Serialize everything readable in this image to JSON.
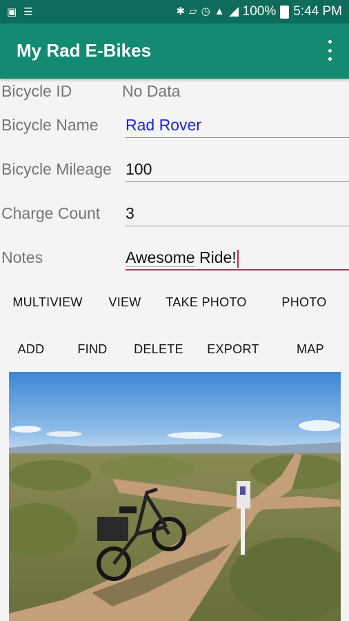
{
  "status_bar": {
    "battery": "100%",
    "time": "5:44 PM"
  },
  "app_bar": {
    "title": "My Rad E-Bikes"
  },
  "form": {
    "bicycle_id": {
      "label": "Bicycle ID",
      "value": "No Data"
    },
    "bicycle_name": {
      "label": "Bicycle Name",
      "value": "Rad Rover"
    },
    "bicycle_mileage": {
      "label": "Bicycle Mileage",
      "value": "100"
    },
    "charge_count": {
      "label": "Charge Count",
      "value": "3"
    },
    "notes": {
      "label": "Notes",
      "value_word1": "Awesome",
      "value_word2": " Ride!"
    }
  },
  "buttons_row1": [
    "MULTIVIEW",
    "VIEW",
    "TAKE PHOTO",
    "PHOTO"
  ],
  "buttons_row2": [
    "ADD",
    "FIND",
    "DELETE",
    "EXPORT",
    "MAP"
  ],
  "colors": {
    "status_bar": "#0f6b5b",
    "app_bar": "#138a72",
    "accent": "#d81b50",
    "link_text": "#1a25d6"
  }
}
